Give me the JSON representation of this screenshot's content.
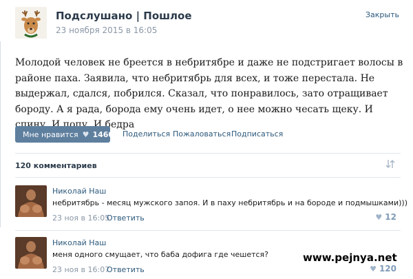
{
  "post": {
    "group_name": "Подслушано | Пошлое",
    "date": "23 ноября 2015 в 16:05",
    "close_label": "Закрыть",
    "text": "Молодой человек не бреется в небритябре и даже не подстригает волосы в районе паха. Заявила, что небритябрь для всех, и тоже перестала. Не выдержал, сдался, побрился. Сказал, что понравилось, зато отращивает бороду. А я рада, борода ему очень идет, о нее можно чесать щеку. И спину. И попу. И бедра"
  },
  "actions": {
    "like_label": "Мне нравится",
    "like_icon": "heart-icon",
    "like_count": "1460",
    "share_label": "Поделиться",
    "report_label": "Пожаловаться",
    "subscribe_label": "Подписаться"
  },
  "comments_header": {
    "count_label": "120 комментариев",
    "sort_icon": "sort-arrows-icon"
  },
  "comments": [
    {
      "author": "Николай Наш",
      "text": "небритябрь - месяц мужского запоя. И в паху небритябрь и на бороде и подмышками)))",
      "date": "23 ноя в 16:05",
      "reply_label": "Ответить",
      "likes": "12"
    },
    {
      "author": "Николай Наш",
      "text": "меня одного смущает, что баба дофига где чешется?",
      "date": "23 ноя в 16:07",
      "reply_label": "Ответить",
      "likes": "120"
    }
  ],
  "watermark": "www.pejnya.net",
  "colors": {
    "link": "#2b587a",
    "like_button": "#5f7f9e",
    "muted": "#8a97a6"
  }
}
